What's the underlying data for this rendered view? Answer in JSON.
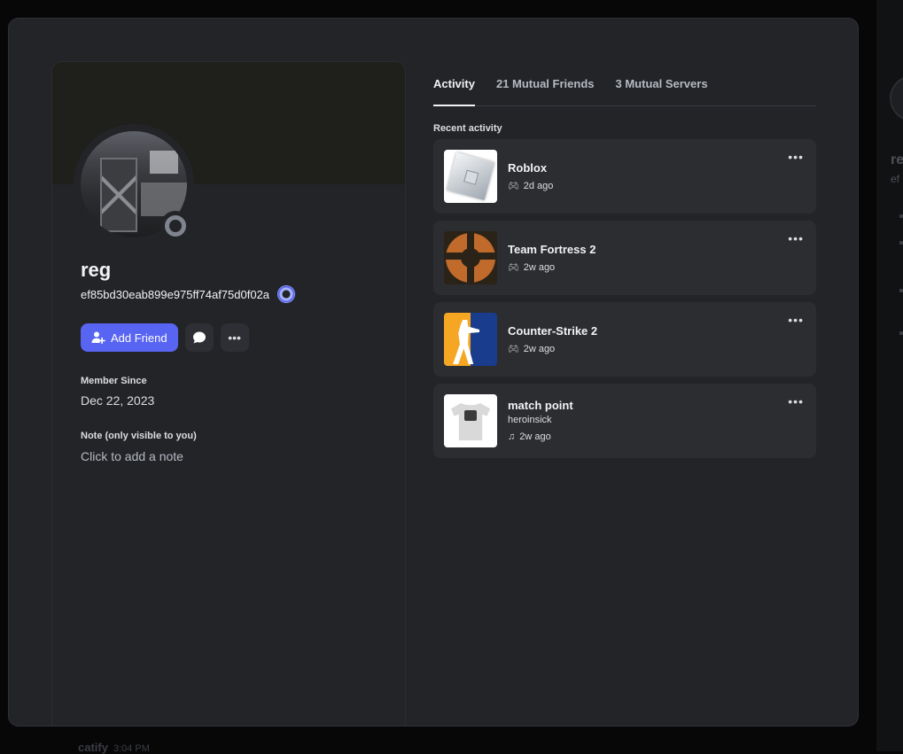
{
  "profile": {
    "username": "reg",
    "tag": "ef85bd30eab899e975ff74af75d0f02a",
    "add_friend_label": "Add Friend",
    "member_since_label": "Member Since",
    "member_since_value": "Dec 22, 2023",
    "note_label": "Note (only visible to you)",
    "note_placeholder": "Click to add a note"
  },
  "tabs": [
    {
      "label": "Activity",
      "active": true
    },
    {
      "label": "21 Mutual Friends",
      "active": false
    },
    {
      "label": "3 Mutual Servers",
      "active": false
    }
  ],
  "recent_activity_label": "Recent activity",
  "activities": [
    {
      "title": "Roblox",
      "time": "2d ago",
      "icon": "gamepad-icon"
    },
    {
      "title": "Team Fortress 2",
      "time": "2w ago",
      "icon": "gamepad-icon"
    },
    {
      "title": "Counter-Strike 2",
      "time": "2w ago",
      "icon": "gamepad-icon"
    },
    {
      "title": "match point",
      "artist": "heroinsick",
      "time": "2w ago",
      "icon": "music-note-icon"
    }
  ],
  "background": {
    "chat_author": "catify",
    "chat_time": "3:04 PM",
    "side_name": "re",
    "side_sub": "ef"
  },
  "colors": {
    "accent": "#5865f2",
    "modal_bg": "#232428",
    "card_bg": "#2b2d31",
    "status_offline": "#80848e"
  }
}
